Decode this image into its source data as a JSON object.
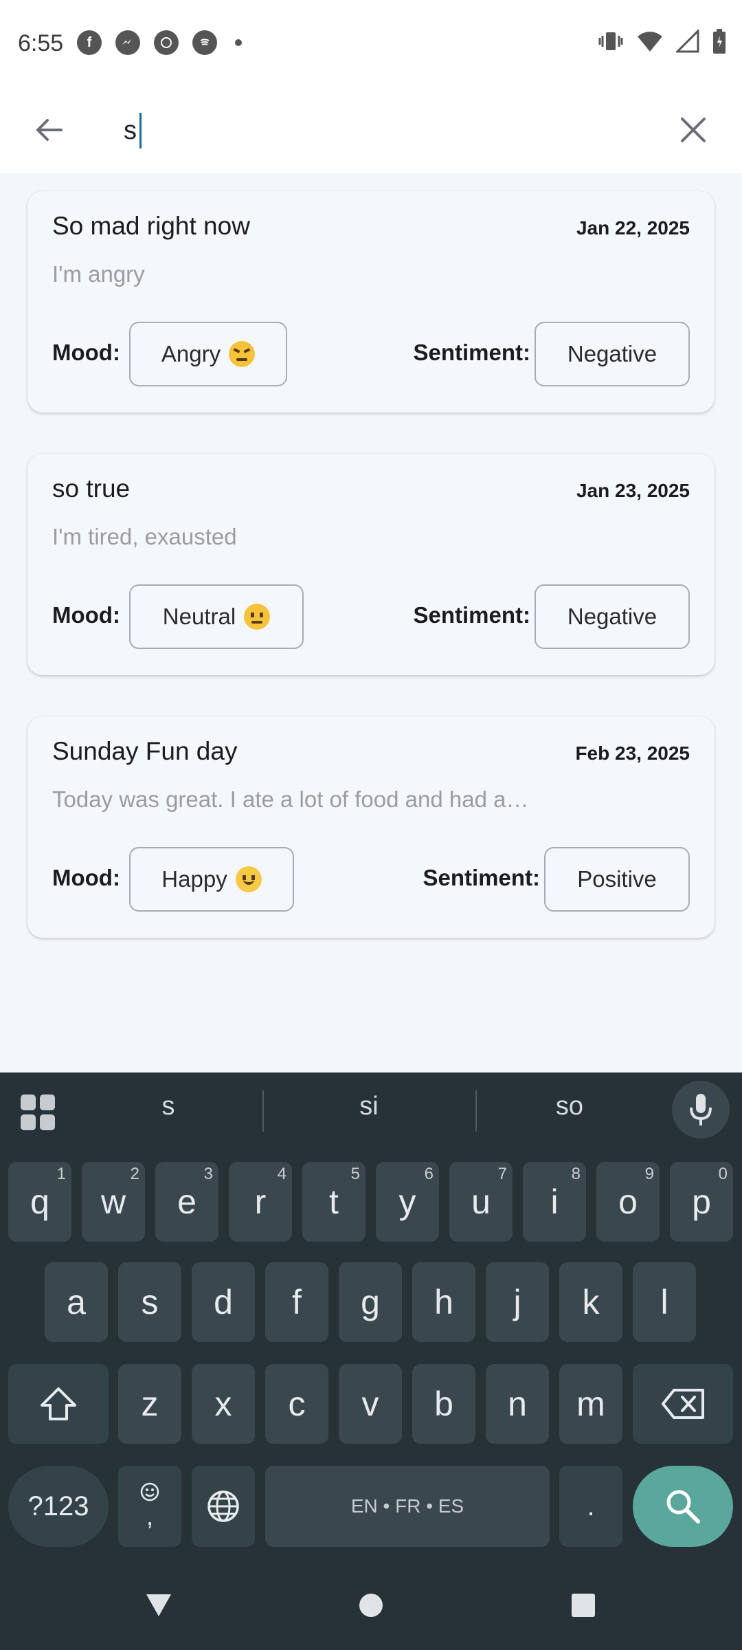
{
  "status_bar": {
    "time": "6:55",
    "left_icons": [
      "facebook-icon",
      "messenger-icon",
      "whatsapp-icon",
      "spotify-icon",
      "notification-dot-icon"
    ],
    "right_icons": [
      "vibrate-icon",
      "wifi-icon",
      "cellular-signal-icon",
      "battery-icon"
    ]
  },
  "search": {
    "value": "s",
    "back_icon": "back-arrow-icon",
    "clear_icon": "close-icon"
  },
  "entries": [
    {
      "title": "So mad right now",
      "date": "Jan 22, 2025",
      "body": "I'm angry",
      "mood_label": "Mood:",
      "mood": "Angry",
      "mood_emoji": "angry-face-icon",
      "sentiment_label": "Sentiment:",
      "sentiment": "Negative"
    },
    {
      "title": "so true",
      "date": "Jan 23, 2025",
      "body": "I'm tired, exausted",
      "mood_label": "Mood:",
      "mood": "Neutral",
      "mood_emoji": "neutral-face-icon",
      "sentiment_label": "Sentiment:",
      "sentiment": "Negative"
    },
    {
      "title": "Sunday Fun day",
      "date": "Feb 23, 2025",
      "body": "Today was great. I ate a lot of food and had a…",
      "mood_label": "Mood:",
      "mood": "Happy",
      "mood_emoji": "smiling-face-icon",
      "sentiment_label": "Sentiment:",
      "sentiment": "Positive"
    }
  ],
  "keyboard": {
    "suggestions": [
      "s",
      "si",
      "so"
    ],
    "row1": [
      {
        "key": "q",
        "hint": "1"
      },
      {
        "key": "w",
        "hint": "2"
      },
      {
        "key": "e",
        "hint": "3"
      },
      {
        "key": "r",
        "hint": "4"
      },
      {
        "key": "t",
        "hint": "5"
      },
      {
        "key": "y",
        "hint": "6"
      },
      {
        "key": "u",
        "hint": "7"
      },
      {
        "key": "i",
        "hint": "8"
      },
      {
        "key": "o",
        "hint": "9"
      },
      {
        "key": "p",
        "hint": "0"
      }
    ],
    "row2": [
      "a",
      "s",
      "d",
      "f",
      "g",
      "h",
      "j",
      "k",
      "l"
    ],
    "row3": [
      "z",
      "x",
      "c",
      "v",
      "b",
      "n",
      "m"
    ],
    "symbols_key": "?123",
    "comma_key": ",",
    "space_label": "EN • FR • ES",
    "period_key": "."
  },
  "navbar": {
    "icons": [
      "back-triangle-icon",
      "home-circle-icon",
      "recents-square-icon"
    ]
  }
}
